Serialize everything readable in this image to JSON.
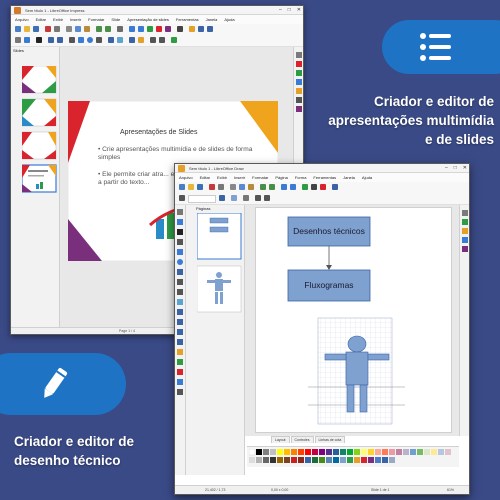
{
  "impress": {
    "title": "Sem título 1 - LibreOffice Impress",
    "menu": [
      "Arquivo",
      "Editar",
      "Exibir",
      "Inserir",
      "Formatar",
      "Slide",
      "Apresentação de slides",
      "Ferramentas",
      "Janela",
      "Ajuda"
    ],
    "panel_label": "Slides",
    "slide": {
      "title": "Apresentações de Slides",
      "bullets": [
        "Crie apresentações multimídia e de slides de forma simples",
        "Ele permite criar atra... e 3D a partir do texto..."
      ]
    },
    "status_text": "Page 1 / 4",
    "colors": {
      "accent_red": "#d9242e",
      "accent_orange": "#f0a31c",
      "accent_purple": "#7a2f7c",
      "accent_green": "#2e9c45"
    }
  },
  "draw": {
    "title": "Sem título 1 - LibreOffice Draw",
    "menu": [
      "Arquivo",
      "Editar",
      "Exibir",
      "Inserir",
      "Formatar",
      "Página",
      "Forma",
      "Ferramentas",
      "Janela",
      "Ajuda"
    ],
    "panel_label": "Páginas",
    "tabs": [
      "Layout",
      "Controles",
      "Linhas de cota"
    ],
    "boxes": {
      "box1": "Desenhos técnicos",
      "box2": "Fluxogramas"
    },
    "status_left": "21,402 / 1,73",
    "status_mid": "0,00 x 0,00",
    "status_page": "Slide 1 de 1",
    "zoom": "61%",
    "colors": {
      "shape_fill": "#7fa1d0",
      "shape_stroke": "#3a64a6"
    }
  },
  "callouts": {
    "presentation": "Criador e editor de apresentações multimídia e de slides",
    "drawing": "Criador e editor de desenho técnico"
  },
  "icons": {
    "top_right": "list-icon",
    "bottom_left": "pencil-icon"
  },
  "theme": {
    "background": "#3a4a86",
    "badge": "#1f73c4"
  }
}
